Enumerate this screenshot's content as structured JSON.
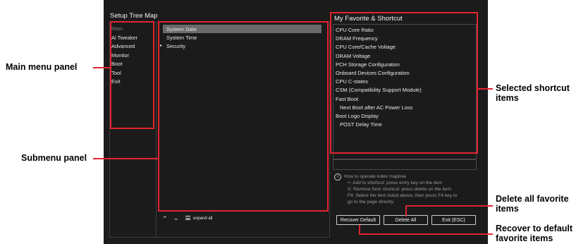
{
  "setup_tree": {
    "title": "Setup Tree Map",
    "main_menu": [
      "Main",
      "Ai Tweaker",
      "Advanced",
      "Monitor",
      "Boot",
      "Tool",
      "Exit"
    ],
    "selected_main": "Main",
    "submenu": [
      {
        "label": "System Date",
        "selected": true,
        "arrow": false
      },
      {
        "label": "System Time",
        "selected": false,
        "arrow": false
      },
      {
        "label": "Security",
        "selected": false,
        "arrow": true
      }
    ],
    "footer": {
      "expand_label": "expand all"
    }
  },
  "favorites": {
    "title": "My Favorite & Shortcut",
    "items": [
      {
        "label": "CPU Core Ratio",
        "indent": false
      },
      {
        "label": "DRAM Frequency",
        "indent": false
      },
      {
        "label": "CPU Core/Cache Voltage",
        "indent": false
      },
      {
        "label": "DRAM Voltage",
        "indent": false
      },
      {
        "label": "PCH Storage Configuration",
        "indent": false
      },
      {
        "label": "Onboard Devices Configuration",
        "indent": false
      },
      {
        "label": "CPU C-states",
        "indent": false
      },
      {
        "label": "CSM (Compatibility Support Module)",
        "indent": false
      },
      {
        "label": "Fast Boot",
        "indent": false
      },
      {
        "label": "Next Boot after AC Power Loss",
        "indent": true
      },
      {
        "label": "Boot Logo Display",
        "indent": false
      },
      {
        "label": "POST Delay Time",
        "indent": true
      }
    ],
    "help_lines": [
      "How to operate index maptree",
      "+: Add to shortcut: press entry key on the item",
      "X: Remove form shortcut: press delete on the item",
      "F4: Select the item listed above, then press F4 key to",
      "go to the page directly."
    ],
    "buttons": {
      "recover": "Recover Default",
      "delete_all": "Delete All",
      "exit": "Exit (ESC)"
    }
  },
  "callouts": {
    "main_menu": "Main menu panel",
    "submenu": "Submenu panel",
    "selected_shortcut": [
      "Selected shortcut",
      "items"
    ],
    "delete_all": [
      "Delete all favorite",
      "items"
    ],
    "recover": [
      "Recover to default",
      "favorite items"
    ]
  },
  "colors": {
    "highlight": "#e3232f",
    "screen_bg": "#1b1b1b",
    "selection_bg": "#6a6a6a"
  }
}
